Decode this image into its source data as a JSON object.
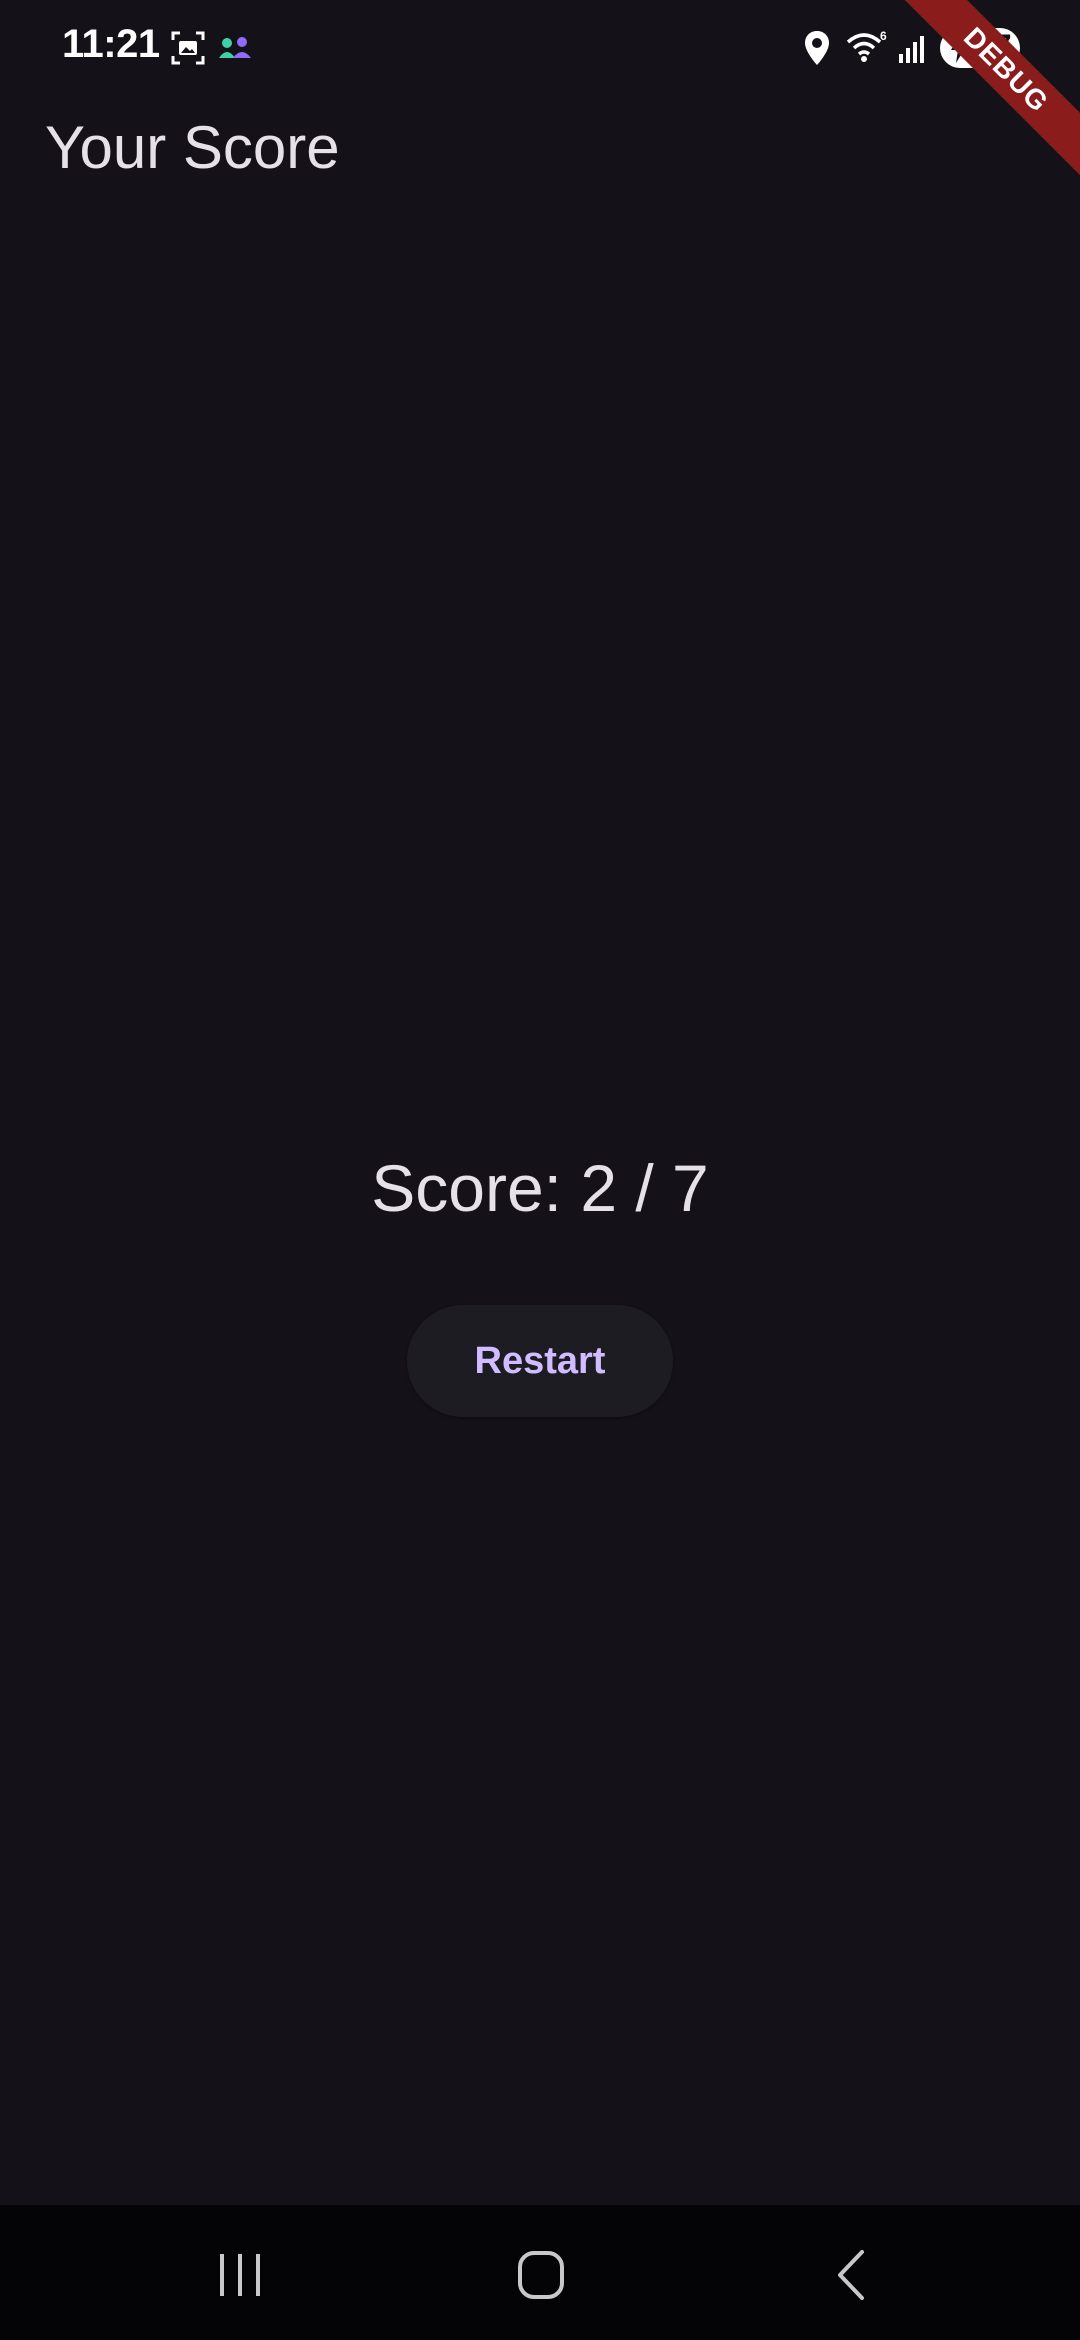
{
  "status_bar": {
    "time": "11:21",
    "battery_level": "77",
    "icons": [
      "screenshot-icon",
      "people-icon",
      "location-icon",
      "wifi-icon",
      "signal-icon",
      "battery-icon"
    ]
  },
  "debug_banner": {
    "label": "DEBUG"
  },
  "app_bar": {
    "title": "Your Score"
  },
  "score": {
    "text": "Score: 2 / 7",
    "correct": 2,
    "total": 7
  },
  "restart_button": {
    "label": "Restart"
  },
  "nav_bar": {
    "icons": [
      "recent-apps-icon",
      "home-icon",
      "back-icon"
    ]
  },
  "colors": {
    "background": "#141218",
    "on_surface": "#e6e0e9",
    "primary": "#d0bcff",
    "button_surface": "#1e1c23",
    "nav_background": "#040406",
    "debug_ribbon": "#8a1c1c"
  }
}
